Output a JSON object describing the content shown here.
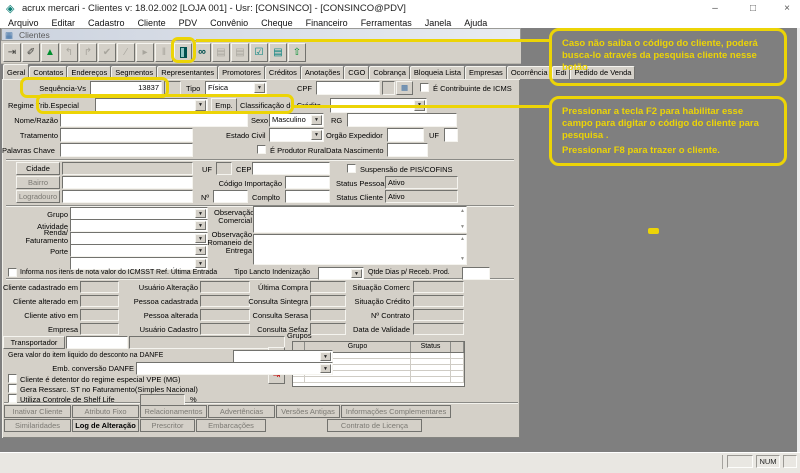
{
  "window": {
    "title": "acrux mercari - Clientes v: 18.02.002 [LOJA 001] - Usr: [CONSINCO] - [CONSINCO@PDV]",
    "app_icon": "◈",
    "minimize": "–",
    "maximize": "□",
    "close": "×"
  },
  "menu": [
    "Arquivo",
    "Editar",
    "Cadastro",
    "Cliente",
    "PDV",
    "Convênio",
    "Cheque",
    "Financeiro",
    "Ferramentas",
    "Janela",
    "Ajuda"
  ],
  "child": {
    "title": "Clientes",
    "icon": "▦"
  },
  "toolbar": {
    "icons": [
      {
        "name": "exit-icon",
        "g": "⇥"
      },
      {
        "name": "erase-icon",
        "g": "✐"
      },
      {
        "name": "post-icon",
        "g": "▲"
      },
      {
        "name": "insert-icon",
        "g": "↰"
      },
      {
        "name": "copy-icon",
        "g": "↱"
      },
      {
        "name": "confirm-icon",
        "g": "✔"
      },
      {
        "name": "cancel-icon",
        "g": "∕"
      },
      {
        "name": "prior-icon",
        "g": "▸"
      },
      {
        "name": "pause-icon",
        "g": "‖"
      },
      {
        "name": "client-search-icon",
        "g": ""
      },
      {
        "name": "binoculars-icon",
        "g": "∞"
      },
      {
        "name": "filter-icon",
        "g": "▤"
      },
      {
        "name": "order-icon",
        "g": "▤"
      },
      {
        "name": "marked-list-icon",
        "g": "☑"
      },
      {
        "name": "record-list-icon",
        "g": "▤"
      },
      {
        "name": "import-icon",
        "g": "⇧"
      }
    ]
  },
  "tabs": [
    "Geral",
    "Contatos",
    "Endereços",
    "Segmentos",
    "Representantes",
    "Promotores",
    "Créditos",
    "Anotações",
    "CGO",
    "Cobrança",
    "Bloqueia Lista",
    "Empresas",
    "Ocorrência",
    "Edi",
    "Pedido de Venda"
  ],
  "form": {
    "labels": {
      "sequencia": "Sequência-Vs",
      "tipo": "Tipo",
      "cpf": "CPF",
      "icms": "É Contribuinte de ICMS",
      "regime": "Regime Trib.Especial",
      "emp": "Emp.",
      "classificacao": "Classificação de Crédito",
      "nome": "Nome/Razão",
      "sexo": "Sexo",
      "rg": "RG",
      "tratamento": "Tratamento",
      "estado_civil": "Estado Civil",
      "orgao_expedidor": "Orgão Expedidor",
      "uf": "UF",
      "palavras_chave": "Palavras Chave",
      "produtor_rural": "É Produtor Rural",
      "data_nascimento": "Data Nascimento",
      "cidade": "Cidade",
      "cep": "CEP",
      "suspensao": "Suspensão de PIS/COFINS",
      "bairro": "Bairro",
      "codigo_importacao": "Código Importação",
      "status_pessoa": "Status Pessoa",
      "logradouro": "Logradouro",
      "numero": "Nº",
      "complto": "Complto",
      "status_cliente": "Status Cliente",
      "grupo": "Grupo",
      "atividade": "Atividade",
      "renda_l1": "Renda/",
      "renda_l2": "Faturamento",
      "porte": "Porte",
      "obs_com_l1": "Observação",
      "obs_com_l2": "Comercial",
      "obs_rom_l1": "Observação",
      "obs_rom_l2": "Romaneio de",
      "obs_rom_l3": "Entrega",
      "informa_icmsst": "Informa nos itens de nota valor do ICMSST Ref. Última Entrada",
      "tipo_lancto": "Tipo Lancto Indenização",
      "qtde_dias": "Qtde Dias p/ Receb. Prod.",
      "cadastrado_em": "Cliente cadastrado em",
      "usuario_alteracao": "Usuário Alteração",
      "ultima_compra": "Última Compra",
      "situacao_comerc": "Situação Comerc",
      "alterado_em": "Cliente alterado em",
      "pessoa_cadastrada": "Pessoa cadastrada",
      "consulta_sintegra": "Consulta Sintegra",
      "situacao_credito": "Situação Crédito",
      "ativo_em": "Cliente ativo em",
      "pessoa_alterada": "Pessoa alterada",
      "consulta_serasa": "Consulta Serasa",
      "n_contrato": "Nº Contrato",
      "empresa": "Empresa",
      "usuario_cadastro": "Usuário Cadastro",
      "consulta_sefaz": "Consulta Sefaz",
      "data_validade": "Data de Validade",
      "transportador": "Transportador",
      "gera_valor_danfe": "Gera valor do item liquido do desconto na DANFE",
      "emb_conversao": "Emb. conversão DANFE",
      "vpe": "Cliente é detentor do regime especial VPE (MG)",
      "ressarc": "Gera Ressarc. ST no Faturamento(Simples Nacional)",
      "shelf_life": "Utiliza Controle de Shelf Life",
      "percent": "%",
      "grupos": "Grupos"
    },
    "values": {
      "sequencia": "13837",
      "tipo": "Física",
      "sexo": "Masculino",
      "status_pessoa": "Ativo",
      "status_cliente": "Ativo"
    }
  },
  "grid": {
    "headers": {
      "grupo": "Grupo",
      "status": "Status"
    }
  },
  "actions": {
    "row1": [
      "Inativar Cliente",
      "Atributo Fixo",
      "Relacionamentos",
      "Advertências",
      "Versões Antigas",
      "Informações Complementares"
    ],
    "row2": [
      "Similaridades",
      "Log de Alteração",
      "Prescritor",
      "Embarcações",
      "Contrato de Licença"
    ]
  },
  "annotations": {
    "box1": "Caso não saiba o código do cliente, poderá busca-lo através da pesquisa cliente nesse botão",
    "box2_p1": "Pressionar a tecla F2 para habilitar esse campo para digitar o código do cliente para pesquisa .",
    "box2_p2": "Pressionar F8 para trazer o cliente."
  },
  "statusbar": {
    "num": "NUM"
  },
  "colors": {
    "annotation_yellow": "#ecd406",
    "mdi_gray": "#7f7f7f",
    "panel_gray": "#d4d0c8",
    "icon_teal": "#00807d"
  }
}
